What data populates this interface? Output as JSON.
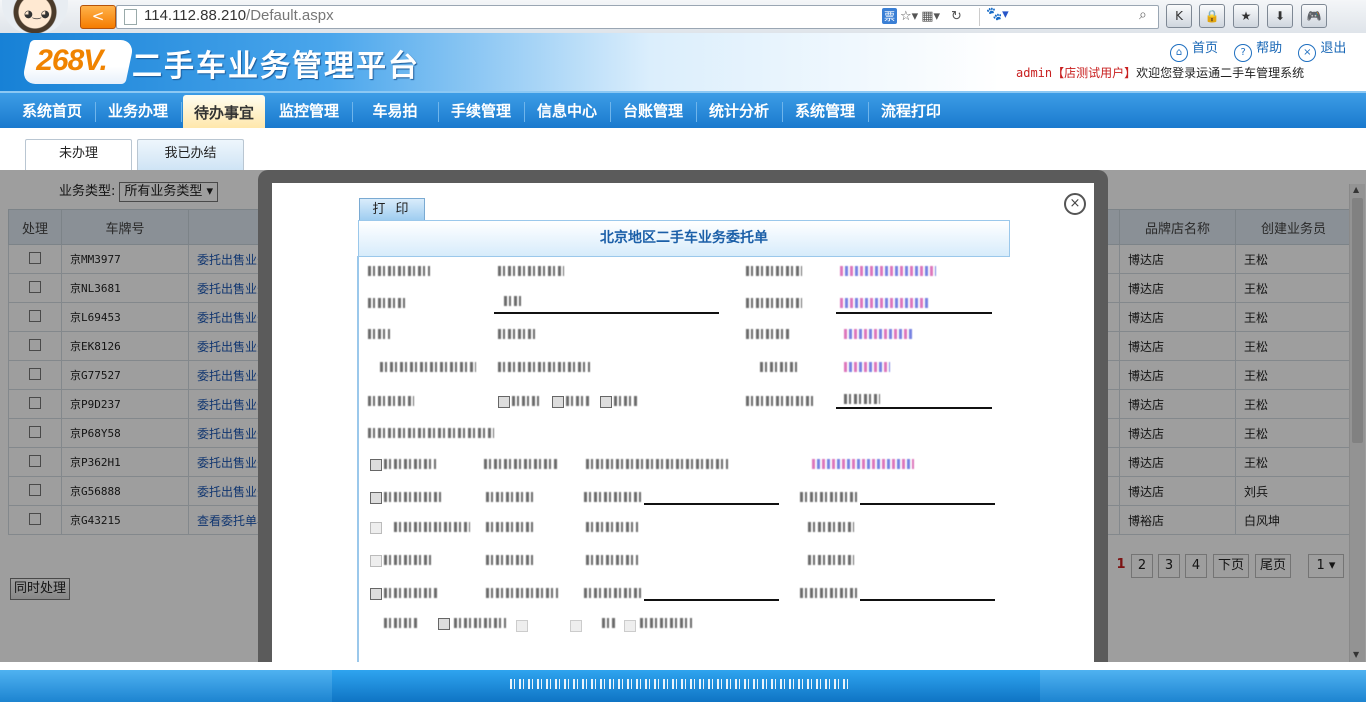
{
  "browser": {
    "url_host": "114.112.88.210",
    "url_path": "/Default.aspx",
    "back_label": "<",
    "ticket_label": "票",
    "buttons": [
      "K",
      "🔒",
      "★",
      "⬇",
      "🎮"
    ]
  },
  "header": {
    "logo_text": "268V.",
    "site_title": "二手车业务管理平台",
    "links": [
      {
        "icon": "⌂",
        "label": "首页"
      },
      {
        "icon": "?",
        "label": "帮助"
      },
      {
        "icon": "×",
        "label": "退出"
      }
    ],
    "user": "admin",
    "user_store": "【店测试用户】",
    "welcome_text": "欢迎您登录运通二手车管理系统"
  },
  "nav": {
    "items": [
      "系统首页",
      "业务办理",
      "待办事宜",
      "监控管理",
      "车易拍",
      "手续管理",
      "信息中心",
      "台账管理",
      "统计分析",
      "系统管理",
      "流程打印"
    ],
    "active": "待办事宜"
  },
  "subtabs": [
    {
      "label": "未办理",
      "active": true
    },
    {
      "label": "我已办结",
      "active": false
    }
  ],
  "filter": {
    "label": "业务类型:",
    "selected": "所有业务类型"
  },
  "table": {
    "columns": [
      "处理",
      "车牌号",
      "品牌店名称",
      "创建业务员"
    ],
    "rows": [
      {
        "plate": "京MM3977",
        "op": "委托出售业务单",
        "store": "博达店",
        "agent": "王松"
      },
      {
        "plate": "京NL3681",
        "op": "委托出售业务单",
        "store": "博达店",
        "agent": "王松"
      },
      {
        "plate": "京L69453",
        "op": "委托出售业务单",
        "store": "博达店",
        "agent": "王松"
      },
      {
        "plate": "京EK8126",
        "op": "委托出售业务单",
        "store": "博达店",
        "agent": "王松"
      },
      {
        "plate": "京G77527",
        "op": "委托出售业务单",
        "store": "博达店",
        "agent": "王松"
      },
      {
        "plate": "京P9D237",
        "op": "委托出售业务单",
        "store": "博达店",
        "agent": "王松"
      },
      {
        "plate": "京P68Y58",
        "op": "委托出售业务单",
        "store": "博达店",
        "agent": "王松"
      },
      {
        "plate": "京P362H1",
        "op": "委托出售业务单",
        "store": "博达店",
        "agent": "王松"
      },
      {
        "plate": "京G56888",
        "op": "委托出售业务单",
        "store": "博达店",
        "agent": "刘兵"
      },
      {
        "plate": "京G43215",
        "op": "查看委托单与确认",
        "store": "博裕店",
        "agent": "白风坤"
      }
    ]
  },
  "pager": {
    "prev": "页",
    "pages": [
      "1",
      "2",
      "3",
      "4"
    ],
    "current": "1",
    "next": "下页",
    "last": "尾页",
    "jump": "1"
  },
  "batch_button": "同时处理",
  "modal": {
    "print_label": "打 印",
    "form_title": "北京地区二手车业务委托单",
    "close_label": "×"
  }
}
